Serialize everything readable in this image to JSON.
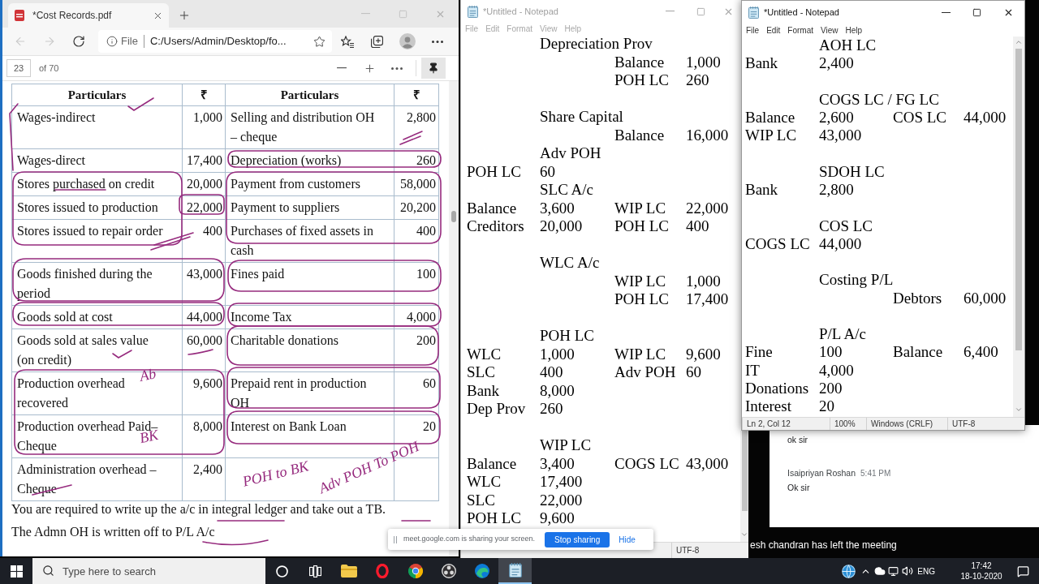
{
  "browser": {
    "tab": {
      "title": "*Cost Records.pdf"
    },
    "nav": [
      {
        "kind": "back",
        "disabled": true
      },
      {
        "kind": "forward",
        "disabled": true
      },
      {
        "kind": "refresh",
        "disabled": false
      }
    ],
    "address": {
      "scheme": "File",
      "url": "C:/Users/Admin/Desktop/fo..."
    },
    "pdf_toolbar": {
      "page": "23",
      "page_count": "of 70"
    },
    "table": {
      "columns": [
        "Particulars",
        "₹",
        "Particulars",
        "₹"
      ],
      "rows": [
        {
          "particulars_1": "Wages-indirect",
          "amount_1": "1,000",
          "particulars_2": "Selling and distribution OH – cheque",
          "amount_2": "2,800"
        },
        {
          "particulars_1": "Wages-direct",
          "amount_1": "17,400",
          "particulars_2": "Depreciation (works)",
          "amount_2": "260"
        },
        {
          "particulars_1": "Stores purchased on credit",
          "amount_1": "20,000",
          "particulars_2": "Payment from customers",
          "amount_2": "58,000"
        },
        {
          "particulars_1": "Stores issued to production",
          "amount_1": "22,000",
          "particulars_2": "Payment to suppliers",
          "amount_2": "20,200"
        },
        {
          "particulars_1": "Stores issued to repair order",
          "amount_1": "400",
          "particulars_2": "Purchases of fixed assets in cash",
          "amount_2": "400"
        },
        {
          "particulars_1": "Goods finished during the period",
          "amount_1": "43,000",
          "particulars_2": "Fines paid",
          "amount_2": "100"
        },
        {
          "particulars_1": "Goods sold at cost",
          "amount_1": "44,000",
          "particulars_2": "Income Tax",
          "amount_2": "4,000"
        },
        {
          "particulars_1": "Goods sold at sales value (on credit)",
          "amount_1": "60,000",
          "particulars_2": "Charitable donations",
          "amount_2": "200"
        },
        {
          "particulars_1": "Production overhead recovered",
          "amount_1": "9,600",
          "particulars_2": "Prepaid rent in production OH",
          "amount_2": "60"
        },
        {
          "particulars_1": "Production overhead Paid– Cheque",
          "amount_1": "8,000",
          "particulars_2": "Interest on Bank Loan",
          "amount_2": "20"
        },
        {
          "particulars_1": "Administration overhead – Cheque",
          "amount_1": "2,400"
        }
      ]
    },
    "notes": [
      "You are required to write up the a/c in integral ledger and take out a TB.",
      "The Admn OH is written off to P/L A/c"
    ],
    "handwriting": [
      {
        "text": "Ab"
      },
      {
        "text": "BK"
      },
      {
        "text": "POH to BK"
      },
      {
        "text": "Adv POH To POH"
      }
    ]
  },
  "notepads": [
    {
      "title": "*Untitled - Notepad",
      "active": false,
      "menu": [
        "File",
        "Edit",
        "Format",
        "View",
        "Help"
      ],
      "lines": [
        {
          "kind": "text",
          "column_2": "Depreciation Prov"
        },
        {
          "kind": "text",
          "column_3": "Balance",
          "column_4": "1,000"
        },
        {
          "kind": "text",
          "column_3": "POH LC",
          "column_4": "260"
        },
        {
          "kind": "blank"
        },
        {
          "kind": "text",
          "column_2": "Share Capital"
        },
        {
          "kind": "text",
          "column_3": "Balance",
          "column_4": "16,000"
        },
        {
          "kind": "text",
          "column_2": "Adv POH"
        },
        {
          "kind": "text",
          "column_1": "POH LC",
          "column_2": "60"
        },
        {
          "kind": "text",
          "column_2": "SLC A/c"
        },
        {
          "kind": "text",
          "column_1": "Balance",
          "column_2": "3,600",
          "column_3": "WIP LC",
          "column_4": "22,000"
        },
        {
          "kind": "text",
          "column_1": "Creditors",
          "column_2": "20,000",
          "column_3": "POH LC",
          "column_4": "400"
        },
        {
          "kind": "blank"
        },
        {
          "kind": "text",
          "column_2": "WLC A/c"
        },
        {
          "kind": "text",
          "column_3": "WIP LC",
          "column_4": "1,000"
        },
        {
          "kind": "text",
          "column_3": "POH LC",
          "column_4": "17,400"
        },
        {
          "kind": "blank"
        },
        {
          "kind": "text",
          "column_2": "POH LC"
        },
        {
          "kind": "text",
          "column_1": "WLC",
          "column_2": "1,000",
          "column_3": "WIP LC",
          "column_4": "9,600"
        },
        {
          "kind": "text",
          "column_1": "SLC",
          "column_2": "400",
          "column_3": "Adv POH",
          "column_4": "60"
        },
        {
          "kind": "text",
          "column_1": "Bank",
          "column_2": "8,000"
        },
        {
          "kind": "text",
          "column_1": "Dep Prov",
          "column_2": "260"
        },
        {
          "kind": "blank"
        },
        {
          "kind": "text",
          "column_2": "WIP LC"
        },
        {
          "kind": "text",
          "column_1": "Balance",
          "column_2": "3,400",
          "column_3": "COGS LC",
          "column_4": "43,000"
        },
        {
          "kind": "text",
          "column_1": "WLC",
          "column_2": "17,400"
        },
        {
          "kind": "text",
          "column_1": "SLC",
          "column_2": "22,000"
        },
        {
          "kind": "text",
          "column_1": "POH LC",
          "column_2": "9,600"
        }
      ],
      "status": [
        "UTF-8"
      ]
    },
    {
      "title": "*Untitled - Notepad",
      "active": true,
      "menu": [
        "File",
        "Edit",
        "Format",
        "View",
        "Help"
      ],
      "lines": [
        {
          "kind": "text",
          "column_2": "AOH LC"
        },
        {
          "kind": "text",
          "column_1": "Bank",
          "column_2": "2,400"
        },
        {
          "kind": "blank"
        },
        {
          "kind": "text",
          "column_2": "COGS LC / FG LC"
        },
        {
          "kind": "text",
          "column_1": "Balance",
          "column_2": "2,600",
          "column_3": "COS LC",
          "column_4": "44,000"
        },
        {
          "kind": "text",
          "column_1": "WIP LC",
          "column_2": "43,000"
        },
        {
          "kind": "blank"
        },
        {
          "kind": "text",
          "column_2": "SDOH LC"
        },
        {
          "kind": "text",
          "column_1": "Bank",
          "column_2": "2,800"
        },
        {
          "kind": "blank"
        },
        {
          "kind": "text",
          "column_2": "COS LC"
        },
        {
          "kind": "text",
          "column_1": "COGS LC",
          "column_2": "44,000"
        },
        {
          "kind": "blank"
        },
        {
          "kind": "text",
          "column_2": "Costing P/L"
        },
        {
          "kind": "text",
          "column_3": "Debtors",
          "column_4": "60,000"
        },
        {
          "kind": "blank"
        },
        {
          "kind": "text",
          "column_2": "P/L A/c"
        },
        {
          "kind": "text",
          "column_1": "Fine",
          "column_2": "100",
          "column_3": "Balance",
          "column_4": "6,400"
        },
        {
          "kind": "text",
          "column_1": "IT",
          "column_2": "4,000"
        },
        {
          "kind": "text",
          "column_1": "Donations",
          "column_2": "200"
        },
        {
          "kind": "text",
          "column_1": "Interest",
          "column_2": "20"
        }
      ],
      "status": [
        "Ln 2, Col 12",
        "100%",
        "Windows (CRLF)",
        "UTF-8"
      ]
    }
  ],
  "chat": {
    "messages": [
      {
        "text": "ok sir"
      },
      {
        "sender": "Isaipriyan Roshan",
        "time": "5:41 PM",
        "text": "Ok sir"
      }
    ]
  },
  "notification": "esh chandran has left the meeting",
  "share_bar": {
    "message": "meet.google.com is sharing your screen.",
    "stop_button": "Stop sharing",
    "hide_link": "Hide"
  },
  "taskbar": {
    "search": {
      "placeholder": "Type here to search"
    },
    "apps": [
      {
        "kind": "cortana",
        "selected": false
      },
      {
        "kind": "task-view",
        "selected": false
      },
      {
        "kind": "file-explorer",
        "selected": false
      },
      {
        "kind": "opera",
        "selected": false
      },
      {
        "kind": "chrome",
        "selected": false
      },
      {
        "kind": "obs",
        "selected": false
      },
      {
        "kind": "edge",
        "selected": false
      },
      {
        "kind": "notepad",
        "selected": true
      }
    ],
    "tray": {
      "language": "ENG",
      "time": "17:42",
      "date": "18-10-2020"
    }
  }
}
